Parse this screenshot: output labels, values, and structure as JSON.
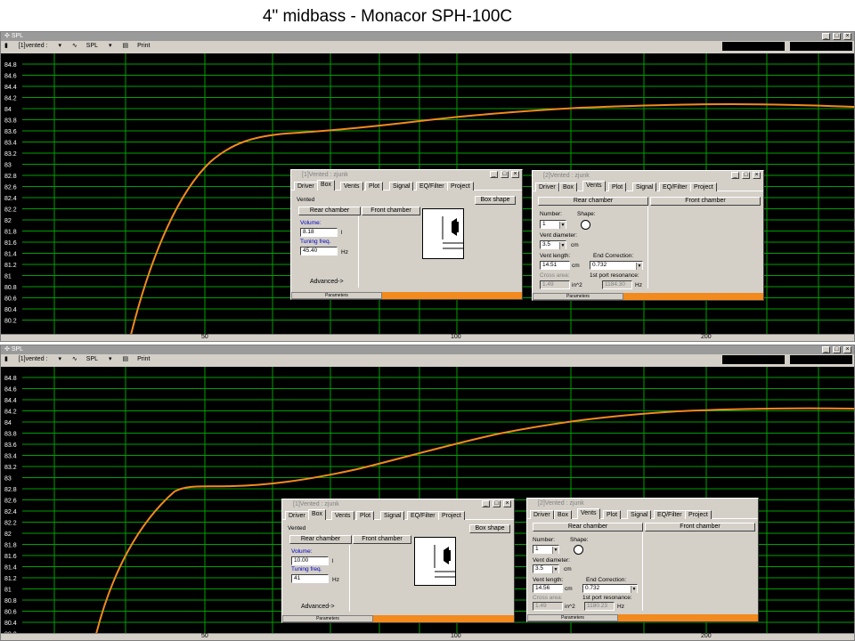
{
  "page_title": "4\" midbass - Monacor SPH-100C",
  "spl_window": {
    "title": "SPL",
    "toolbar": {
      "vented": "[1]vented :",
      "spl": "SPL",
      "print": "Print"
    },
    "y_ticks": [
      "84.8",
      "84.6",
      "84.4",
      "84.2",
      "84",
      "83.8",
      "83.6",
      "83.4",
      "83.2",
      "83",
      "82.8",
      "82.6",
      "82.4",
      "82.2",
      "82",
      "81.8",
      "81.6",
      "81.4",
      "81.2",
      "81",
      "80.8",
      "80.6",
      "80.4",
      "80.2"
    ],
    "x_ticks": [
      "50",
      "100",
      "200"
    ],
    "curve_color": "#f28a1e",
    "grid_color": "#00a000"
  },
  "top_dialogs": {
    "box": {
      "title": "[1]Vented : zjunk",
      "tabs": [
        "Driver",
        "Box",
        "Vents",
        "Plot",
        "Signal",
        "EQ/Filter",
        "Project"
      ],
      "box_type": "Vented",
      "box_shape_btn": "Box shape",
      "rear_btn": "Rear chamber",
      "front_btn": "Front chamber",
      "volume_label": "Volume:",
      "volume_value": "8.18",
      "volume_unit": "l",
      "tuning_label": "Tuning freq.",
      "tuning_value": "45.40",
      "tuning_unit": "Hz",
      "advanced": "Advanced->",
      "status": "Parameters"
    },
    "vents": {
      "title": "[2]Vented : zjunk",
      "tabs": [
        "Driver",
        "Box",
        "Vents",
        "Plot",
        "Signal",
        "EQ/Filter",
        "Project"
      ],
      "rear_btn": "Rear chamber",
      "front_btn": "Front chamber",
      "number_label": "Number:",
      "number_value": "1",
      "shape_label": "Shape:",
      "diam_label": "Vent diameter:",
      "diam_value": "3.5",
      "diam_unit": "cm",
      "length_label": "Vent length:",
      "length_value": "14.51",
      "length_unit": "cm",
      "endcorr_label": "End Correction:",
      "endcorr_value": "0.732",
      "cross_label": "Cross area:",
      "cross_value": "1.49",
      "cross_unit": "in^2",
      "res_label": "1st port resonance:",
      "res_value": "1184.30",
      "res_unit": "Hz",
      "status": "Parameters"
    }
  },
  "bottom_dialogs": {
    "box": {
      "title": "[1]Vented : zjunk",
      "tabs": [
        "Driver",
        "Box",
        "Vents",
        "Plot",
        "Signal",
        "EQ/Filter",
        "Project"
      ],
      "box_type": "Vented",
      "box_shape_btn": "Box shape",
      "rear_btn": "Rear chamber",
      "front_btn": "Front chamber",
      "volume_label": "Volume:",
      "volume_value": "10.00",
      "volume_unit": "l",
      "tuning_label": "Tuning freq.",
      "tuning_value": "41",
      "tuning_unit": "Hz",
      "advanced": "Advanced->",
      "status": "Parameters"
    },
    "vents": {
      "title": "[2]Vented : zjunk",
      "tabs": [
        "Driver",
        "Box",
        "Vents",
        "Plot",
        "Signal",
        "EQ/Filter",
        "Project"
      ],
      "rear_btn": "Rear chamber",
      "front_btn": "Front chamber",
      "number_label": "Number:",
      "number_value": "1",
      "shape_label": "Shape:",
      "diam_label": "Vent diameter:",
      "diam_value": "3.5",
      "diam_unit": "cm",
      "length_label": "Vent length:",
      "length_value": "14.56",
      "length_unit": "cm",
      "endcorr_label": "End Correction:",
      "endcorr_value": "0.732",
      "cross_label": "Cross area:",
      "cross_value": "1.49",
      "cross_unit": "in^2",
      "res_label": "1st port resonance:",
      "res_value": "1180.23",
      "res_unit": "Hz",
      "status": "Parameters"
    }
  }
}
